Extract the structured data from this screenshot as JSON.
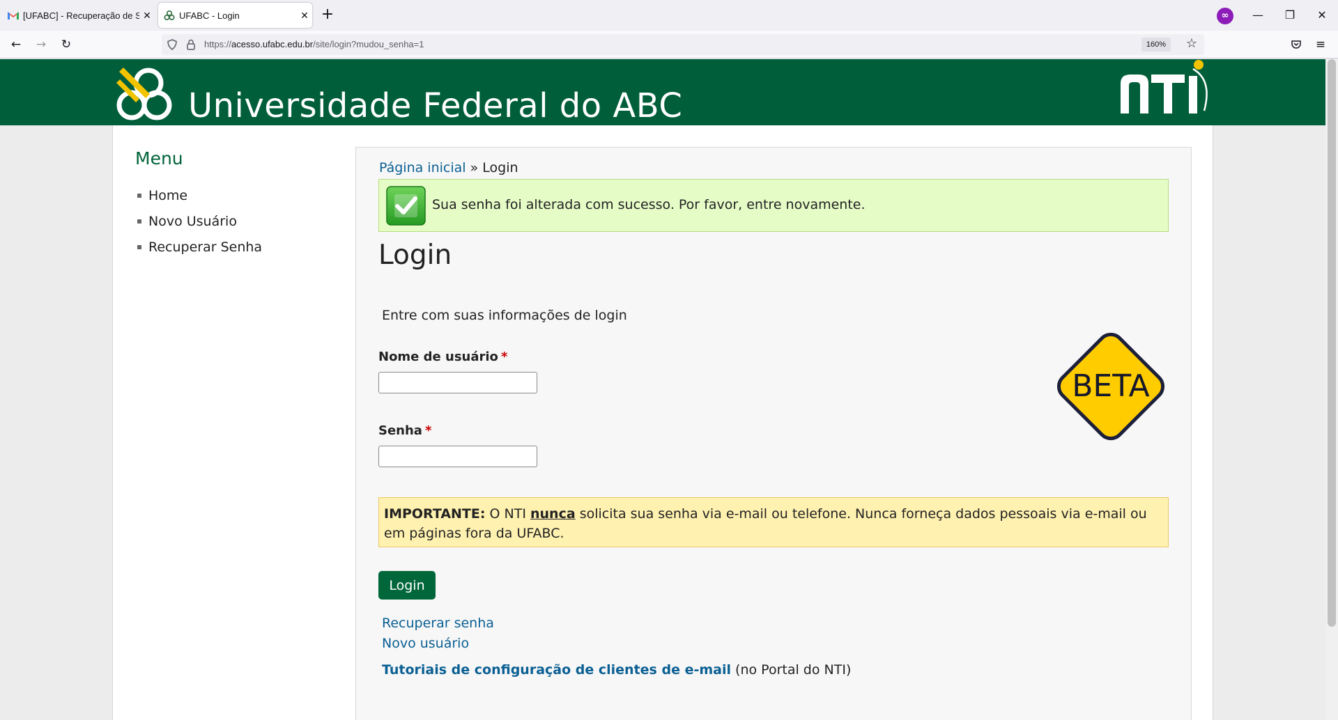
{
  "browser": {
    "tabs": [
      {
        "title": "[UFABC] - Recuperação de Senha",
        "favicon": "gmail-icon",
        "active": false
      },
      {
        "title": "UFABC - Login",
        "favicon": "ufabc-icon",
        "active": true
      }
    ],
    "url": "https://acesso.ufabc.edu.br/site/login?mudou_senha=1",
    "url_host": "acesso.ufabc.edu.br",
    "url_prefix": "https://",
    "url_path": "/site/login?mudou_senha=1",
    "zoom": "160%"
  },
  "header": {
    "university_name": "Universidade Federal do ABC",
    "brand_color": "#005e3b"
  },
  "sidebar": {
    "title": "Menu",
    "items": [
      {
        "label": "Home"
      },
      {
        "label": "Novo Usuário"
      },
      {
        "label": "Recuperar Senha"
      }
    ]
  },
  "breadcrumb": {
    "home": "Página inicial",
    "separator": "»",
    "current": "Login"
  },
  "success_message": "Sua senha foi alterada com sucesso. Por favor, entre novamente.",
  "login": {
    "title": "Login",
    "intro": "Entre com suas informações de login",
    "username_label": "Nome de usuário",
    "username_value": "",
    "password_label": "Senha",
    "password_value": "",
    "required_mark": "*",
    "button": "Login",
    "badge": "BETA"
  },
  "warning": {
    "strong": "IMPORTANTE:",
    "part1": "O NTI",
    "emphasis": "nunca",
    "part2": "solicita sua senha via e-mail ou telefone. Nunca forneça dados pessoais via e-mail ou em páginas fora da UFABC."
  },
  "links": {
    "recover": "Recuperar senha",
    "new_user": "Novo usuário",
    "tutorials": "Tutoriais de configuração de clientes de e-mail",
    "tutorials_suffix": "(no Portal do NTI)"
  }
}
